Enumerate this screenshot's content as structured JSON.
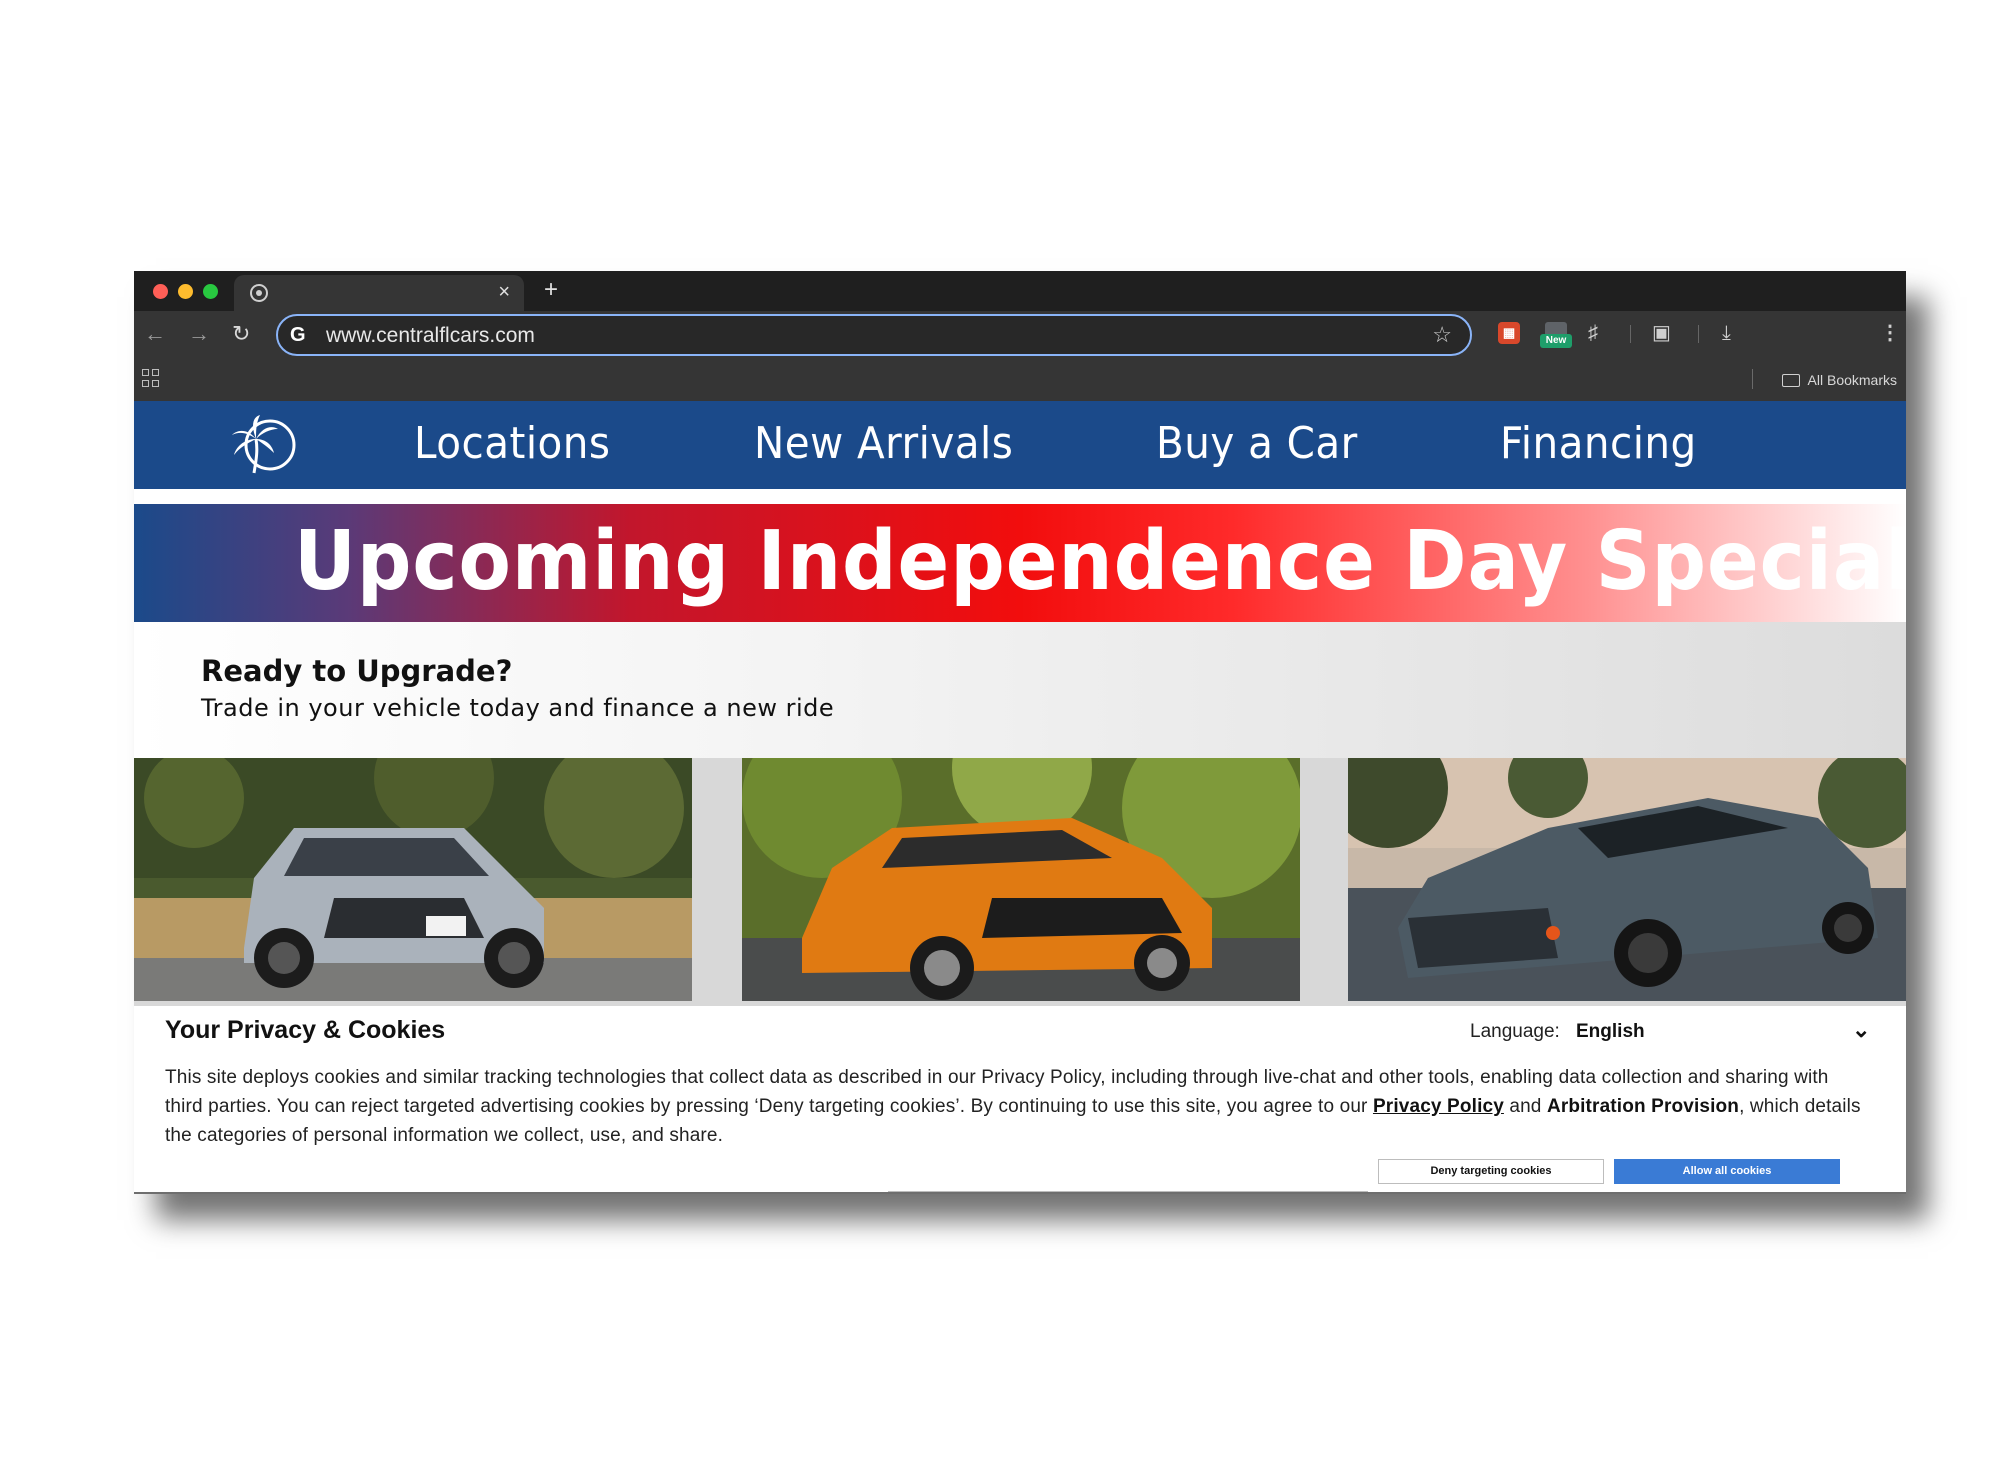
{
  "browser": {
    "tab_close": "×",
    "new_tab": "+",
    "url": "www.centralflcars.com",
    "extension_badge": "New",
    "bookmarks_label": "All Bookmarks"
  },
  "site": {
    "nav": [
      "Locations",
      "New Arrivals",
      "Buy a Car",
      "Financing"
    ],
    "banner": "Upcoming Independence Day Specials",
    "promo_title": "Ready to Upgrade?",
    "promo_subtitle": "Trade in your vehicle today and finance a new ride",
    "photos": [
      {
        "description_icon": "silver-suv-photo"
      },
      {
        "description_icon": "orange-sports-car-photo"
      },
      {
        "description_icon": "gray-coupe-photo"
      }
    ]
  },
  "cookie": {
    "title": "Your Privacy & Cookies",
    "language_label": "Language:",
    "language_value": "English",
    "text_part1": "This site deploys cookies and similar tracking technologies that collect data as described in our Privacy Policy, including through live-chat and other tools, enabling data collection and sharing with third parties. You can reject targeted advertising cookies by pressing ‘Deny targeting cookies’. By continuing to use this site, you agree to our ",
    "privacy_link": "Privacy Policy",
    "text_and": " and ",
    "arbitration": "Arbitration Provision",
    "text_part2": ", which details the categories of personal information we collect, use, and share.",
    "deny_button": "Deny targeting cookies",
    "allow_button": "Allow all cookies"
  },
  "colors": {
    "nav_blue": "#1b4a8a",
    "banner_red": "#f20d0d",
    "allow_blue": "#3a7bd5"
  }
}
